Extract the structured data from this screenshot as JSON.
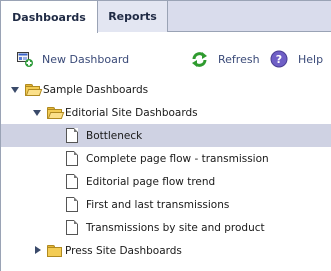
{
  "tabs": [
    {
      "label": "Dashboards",
      "active": true
    },
    {
      "label": "Reports",
      "active": false
    }
  ],
  "toolbar": {
    "new_label": "New Dashboard",
    "refresh_label": "Refresh",
    "help_label": "Help"
  },
  "tree": {
    "root": {
      "label": "Sample Dashboards",
      "expanded": true
    },
    "editorial": {
      "label": "Editorial Site Dashboards",
      "expanded": true
    },
    "items": [
      {
        "label": "Bottleneck",
        "selected": true
      },
      {
        "label": "Complete page flow - transmission"
      },
      {
        "label": "Editorial page flow trend"
      },
      {
        "label": "First and last transmissions"
      },
      {
        "label": "Transmissions by site and product"
      }
    ],
    "press": {
      "label": "Press Site Dashboards",
      "expanded": false
    }
  },
  "colors": {
    "selected_row": "#cfd2e3",
    "tab_bar": "#d9dcec",
    "link_text": "#3a4a78",
    "folder": "#f3cc54"
  }
}
